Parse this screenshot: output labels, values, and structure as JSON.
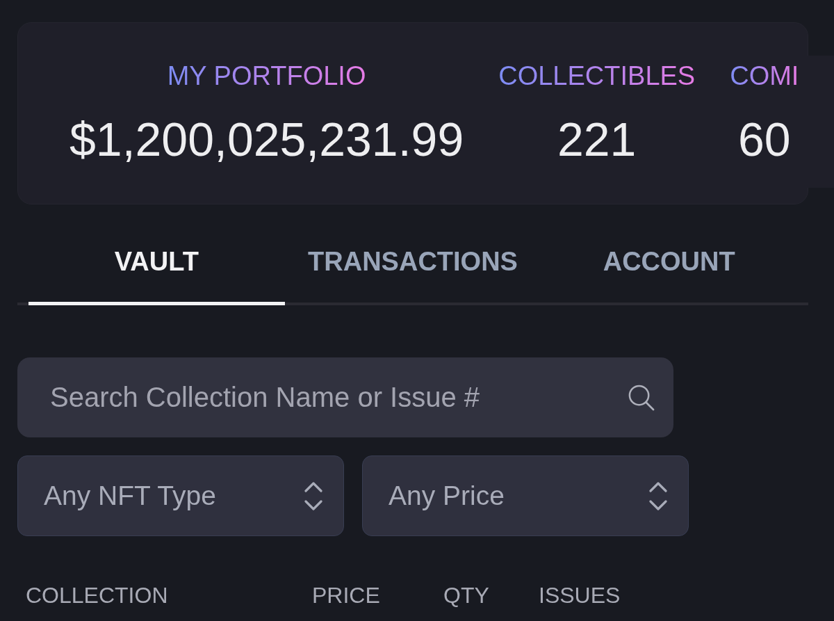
{
  "stats": [
    {
      "label": "MY PORTFOLIO",
      "value": "$1,200,025,231.99"
    },
    {
      "label": "COLLECTIBLES",
      "value": "221"
    },
    {
      "label": "COMI",
      "value": "60"
    }
  ],
  "tabs": [
    {
      "label": "VAULT",
      "selected": true
    },
    {
      "label": "TRANSACTIONS",
      "selected": false
    },
    {
      "label": "ACCOUNT",
      "selected": false
    }
  ],
  "search": {
    "placeholder": "Search Collection Name or Issue #"
  },
  "filters": [
    {
      "value": "Any NFT Type"
    },
    {
      "value": "Any Price"
    }
  ],
  "table": {
    "columns": [
      "COLLECTION",
      "PRICE",
      "QTY",
      "ISSUES"
    ]
  }
}
